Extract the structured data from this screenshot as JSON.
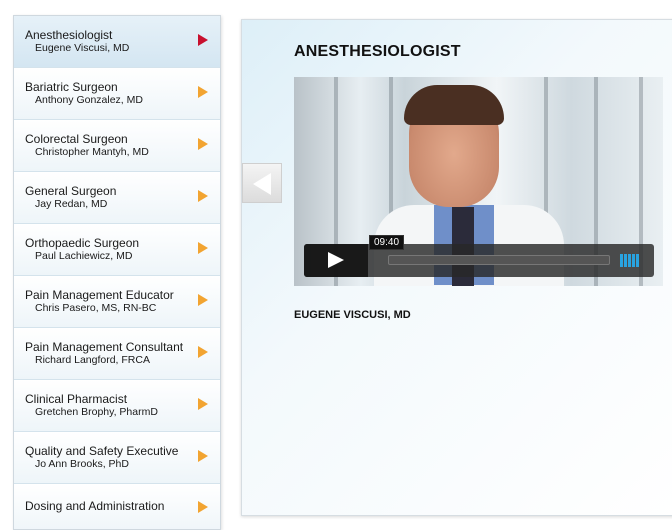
{
  "sidebar": {
    "items": [
      {
        "title": "Anesthesiologist",
        "name": "Eugene Viscusi, MD",
        "active": true
      },
      {
        "title": "Bariatric Surgeon",
        "name": "Anthony Gonzalez, MD"
      },
      {
        "title": "Colorectal Surgeon",
        "name": "Christopher Mantyh, MD"
      },
      {
        "title": "General Surgeon",
        "name": "Jay Redan, MD"
      },
      {
        "title": "Orthopaedic Surgeon",
        "name": "Paul Lachiewicz, MD"
      },
      {
        "title": "Pain Management Educator",
        "name": "Chris Pasero, MS, RN-BC"
      },
      {
        "title": "Pain Management Consultant",
        "name": "Richard Langford, FRCA"
      },
      {
        "title": "Clinical Pharmacist",
        "name": "Gretchen Brophy, PharmD"
      },
      {
        "title": "Quality and Safety Executive",
        "name": "Jo Ann Brooks, PhD"
      },
      {
        "title": "Dosing and Administration",
        "name": ""
      }
    ]
  },
  "panel": {
    "title": "ANESTHESIOLOGIST",
    "person_name": "EUGENE VISCUSI, MD",
    "video": {
      "time": "09:40"
    }
  },
  "icons": {
    "arrow": "chevron-right-icon",
    "back": "arrow-left-icon",
    "play": "play-icon",
    "volume": "volume-icon"
  },
  "colors": {
    "arrow": "#f2a431",
    "arrow_active": "#c8102e",
    "volume": "#29a3e0"
  }
}
